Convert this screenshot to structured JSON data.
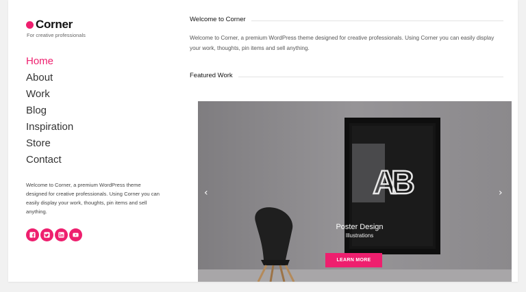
{
  "brand": {
    "name": "Corner",
    "tagline": "For creative professionals"
  },
  "nav": [
    "Home",
    "About",
    "Work",
    "Blog",
    "Inspiration",
    "Store",
    "Contact"
  ],
  "nav_active": "Home",
  "sidebar_text": "Welcome to Corner, a premium WordPress theme designed for creative professionals. Using Corner you can easily display your work, thoughts, pin items and sell anything.",
  "social_icons": [
    "facebook-icon",
    "twitter-icon",
    "linkedin-icon",
    "youtube-icon"
  ],
  "welcome": {
    "title": "Welcome to Corner",
    "text": "Welcome to Corner, a premium WordPress theme designed for creative professionals. Using Corner you can easily display your work, thoughts, pin items and sell anything."
  },
  "featured": {
    "title": "Featured Work",
    "slide": {
      "title": "Poster Design",
      "subtitle": "Illustrations",
      "button": "LEARN MORE",
      "poster_letters": "AB"
    },
    "prev_arrow": "‹",
    "next_arrow": "›"
  },
  "colors": {
    "accent": "#ee1f6e",
    "wall": "#8e8c8f"
  }
}
